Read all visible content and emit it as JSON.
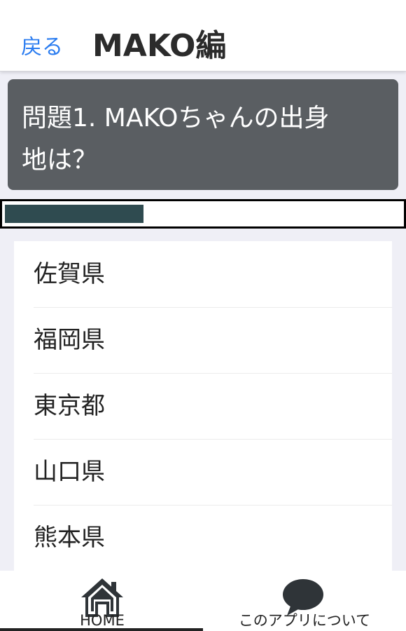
{
  "header": {
    "back_label": "戻る",
    "title": "MAKO編"
  },
  "question": {
    "line1": "問題1. MAKOちゃんの出身",
    "line2": "地は？"
  },
  "progress": {
    "fraction": 0.35
  },
  "choices": [
    "佐賀県",
    "福岡県",
    "東京都",
    "山口県",
    "熊本県"
  ],
  "tabs": {
    "home_label": "HOME",
    "about_label": "このアプリについて"
  },
  "colors": {
    "accent": "#2a7cf0",
    "question_bg": "#5a5e62",
    "progress_fill": "#2f4b50",
    "icon": "#2f3438"
  },
  "icons": {
    "home": "home-icon",
    "about": "speech-bubble-icon"
  }
}
